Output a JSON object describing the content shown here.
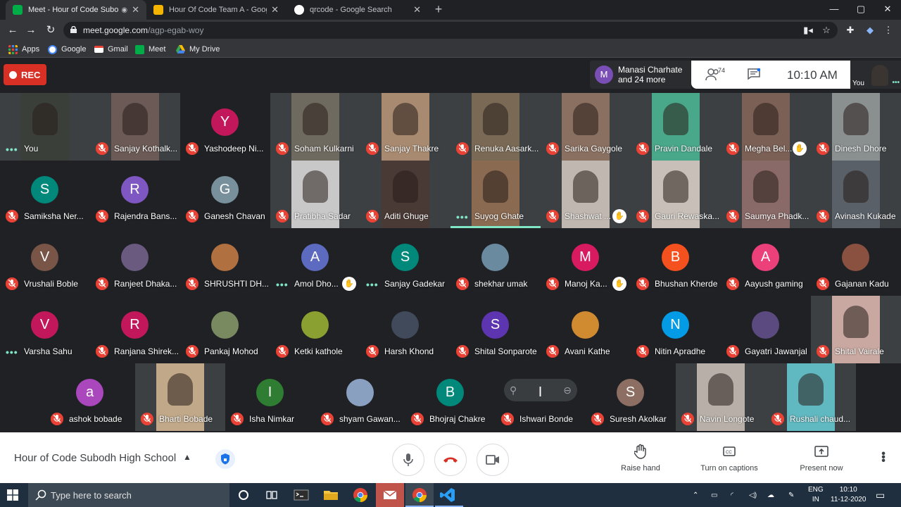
{
  "browser": {
    "tabs": [
      {
        "title": "Meet - Hour of Code Subodh",
        "favicon_color": "#00ac47",
        "active": true
      },
      {
        "title": "Hour Of Code Team A - Google S",
        "favicon_color": "#f4b400",
        "active": false
      },
      {
        "title": "qrcode - Google Search",
        "favicon_color": "#4285f4",
        "active": false
      }
    ],
    "url_host": "meet.google.com",
    "url_path": "/agp-egab-woy",
    "bookmarks": [
      {
        "label": "Apps",
        "icon": "apps-grid-icon",
        "color": "#ea4335"
      },
      {
        "label": "Google",
        "icon": "google-icon",
        "color": "#4285f4"
      },
      {
        "label": "Gmail",
        "icon": "gmail-icon",
        "color": "#ea4335"
      },
      {
        "label": "Meet",
        "icon": "meet-icon",
        "color": "#00ac47"
      },
      {
        "label": "My Drive",
        "icon": "drive-icon",
        "color": "#fbbc04"
      }
    ]
  },
  "meet": {
    "rec_label": "REC",
    "presenting": {
      "avatar_letter": "M",
      "line1": "Manasi Charhate",
      "line2": "and 24 more"
    },
    "participant_count": "74",
    "time": "10:10  AM",
    "self_label": "You",
    "tiles": [
      [
        {
          "name": "You",
          "type": "video",
          "color": "#3a3f3a",
          "status": "dots"
        },
        {
          "name": "Sanjay Kothalk...",
          "type": "video",
          "color": "#6b5a55",
          "status": "muted"
        },
        {
          "name": "Yashodeep Ni...",
          "type": "avatar",
          "letter": "Y",
          "color": "#c2185b",
          "status": "muted"
        },
        {
          "name": "Soham Kulkarni",
          "type": "video",
          "color": "#6f6a60",
          "status": "muted"
        },
        {
          "name": "Sanjay Thakre",
          "type": "video",
          "color": "#a88a70",
          "status": "muted"
        },
        {
          "name": "Renuka Aasark...",
          "type": "video",
          "color": "#7a6a55",
          "status": "muted"
        },
        {
          "name": "Sarika Gaygole",
          "type": "video",
          "color": "#8a7060",
          "status": "muted"
        },
        {
          "name": "Pravin Dandale",
          "type": "video",
          "color": "#4aa88a",
          "status": "muted"
        },
        {
          "name": "Megha Bel...",
          "type": "video",
          "color": "#7a6055",
          "status": "muted",
          "hand": true
        },
        {
          "name": "Dinesh Dhore",
          "type": "video",
          "color": "#8a8f90",
          "status": "muted"
        }
      ],
      [
        {
          "name": "Samiksha Ner...",
          "type": "avatar",
          "letter": "S",
          "color": "#00897b",
          "status": "muted"
        },
        {
          "name": "Rajendra Bans...",
          "type": "avatar",
          "letter": "R",
          "color": "#7e57c2",
          "status": "muted"
        },
        {
          "name": "Ganesh Chavan",
          "type": "avatar",
          "letter": "G",
          "color": "#78909c",
          "status": "muted"
        },
        {
          "name": "Pratibha Sadar",
          "type": "video",
          "color": "#c8c8c8",
          "status": "muted"
        },
        {
          "name": "Aditi Ghuge",
          "type": "video",
          "color": "#4a3a35",
          "status": "muted"
        },
        {
          "name": "Suyog Ghate",
          "type": "video",
          "color": "#8a6a50",
          "status": "dots",
          "speaking": true
        },
        {
          "name": "Shashwat ...",
          "type": "video",
          "color": "#c0b8b0",
          "status": "muted",
          "hand": true
        },
        {
          "name": "Gauri Rewaska...",
          "type": "video",
          "color": "#c8c0b8",
          "status": "muted"
        },
        {
          "name": "Saumya Phadk...",
          "type": "video",
          "color": "#8a6a68",
          "status": "muted"
        },
        {
          "name": "Avinash Kukade",
          "type": "video",
          "color": "#5a6068",
          "status": "muted"
        }
      ],
      [
        {
          "name": "Vrushali Boble",
          "type": "avatar",
          "letter": "V",
          "color": "#795548",
          "status": "muted"
        },
        {
          "name": "Ranjeet Dhaka...",
          "type": "photo",
          "color": "#6a5a80",
          "status": "muted"
        },
        {
          "name": "SHRUSHTI DH...",
          "type": "photo",
          "color": "#b07040",
          "status": "muted"
        },
        {
          "name": "Amol Dho...",
          "type": "avatar",
          "letter": "A",
          "color": "#5c6bc0",
          "status": "dots",
          "hand": true
        },
        {
          "name": "Sanjay Gadekar",
          "type": "avatar",
          "letter": "S",
          "color": "#00897b",
          "status": "dots"
        },
        {
          "name": "shekhar umak",
          "type": "photo",
          "color": "#6a8aa0",
          "status": "muted"
        },
        {
          "name": "Manoj Ka...",
          "type": "avatar",
          "letter": "M",
          "color": "#d81b60",
          "status": "muted",
          "hand": true
        },
        {
          "name": "Bhushan Kherde",
          "type": "avatar",
          "letter": "B",
          "color": "#f4511e",
          "status": "muted"
        },
        {
          "name": "Aayush gaming",
          "type": "avatar",
          "letter": "A",
          "color": "#ec407a",
          "status": "muted"
        },
        {
          "name": "Gajanan Kadu",
          "type": "photo",
          "color": "#8a5040",
          "status": "muted"
        }
      ],
      [
        {
          "name": "Varsha Sahu",
          "type": "avatar",
          "letter": "V",
          "color": "#c2185b",
          "status": "dots"
        },
        {
          "name": "Ranjana Shirek...",
          "type": "avatar",
          "letter": "R",
          "color": "#c2185b",
          "status": "muted"
        },
        {
          "name": "Pankaj Mohod",
          "type": "photo",
          "color": "#7a8a60",
          "status": "muted"
        },
        {
          "name": "Ketki kathole",
          "type": "photo",
          "color": "#8aa030",
          "status": "muted"
        },
        {
          "name": "Harsh Khond",
          "type": "photo",
          "color": "#404a5a",
          "status": "muted"
        },
        {
          "name": "Shital Sonparote",
          "type": "avatar",
          "letter": "S",
          "color": "#5e35b1",
          "status": "muted"
        },
        {
          "name": "Avani Kathe",
          "type": "photo",
          "color": "#d08a30",
          "status": "muted"
        },
        {
          "name": "Nitin Apradhe",
          "type": "avatar",
          "letter": "N",
          "color": "#039be5",
          "status": "muted"
        },
        {
          "name": "Gayatri Jawanjal",
          "type": "photo",
          "color": "#5a4a80",
          "status": "muted"
        },
        {
          "name": "Shital Vairale",
          "type": "video",
          "color": "#c8a8a0",
          "status": "muted"
        }
      ],
      [
        {
          "name": "ashok bobade",
          "type": "avatar",
          "letter": "a",
          "color": "#ab47bc",
          "status": "muted"
        },
        {
          "name": "Bharti Bobade",
          "type": "video",
          "color": "#c0a888",
          "status": "muted"
        },
        {
          "name": "Isha Nimkar",
          "type": "avatar",
          "letter": "I",
          "color": "#2e7d32",
          "status": "muted"
        },
        {
          "name": "shyam Gawan...",
          "type": "photo",
          "color": "#8aa0c0",
          "status": "muted"
        },
        {
          "name": "Bhojraj Chakre",
          "type": "avatar",
          "letter": "B",
          "color": "#00897b",
          "status": "muted"
        },
        {
          "name": "Ishwari Bonde",
          "type": "avatar",
          "letter": "I",
          "color": "#6d4c41",
          "status": "muted",
          "pinbar": true
        },
        {
          "name": "Suresh Akolkar",
          "type": "avatar",
          "letter": "S",
          "color": "#8d6e63",
          "status": "muted"
        },
        {
          "name": "Navin Longote",
          "type": "video",
          "color": "#b8b0a8",
          "status": "muted"
        },
        {
          "name": "Rushali chaud...",
          "type": "video",
          "color": "#60b8c0",
          "status": "muted"
        }
      ]
    ],
    "meeting_title": "Hour of Code Subodh High School",
    "actions": [
      {
        "label": "Raise hand",
        "icon": "raise-hand-icon"
      },
      {
        "label": "Turn on captions",
        "icon": "captions-icon"
      },
      {
        "label": "Present now",
        "icon": "present-now-icon"
      }
    ]
  },
  "taskbar": {
    "search_placeholder": "Type here to search",
    "lang1": "ENG",
    "lang2": "IN",
    "time": "10:10",
    "date": "11-12-2020"
  }
}
